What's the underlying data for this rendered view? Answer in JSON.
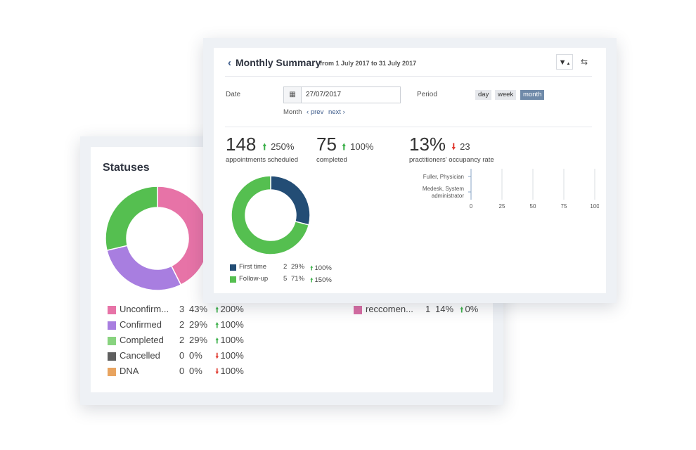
{
  "statuses": {
    "title": "Statuses",
    "items": [
      {
        "label": "Unconfirm...",
        "count": "3",
        "percent": "43%",
        "change": "200%",
        "direction": "up",
        "color": "#e773a7"
      },
      {
        "label": "Confirmed",
        "count": "2",
        "percent": "29%",
        "change": "100%",
        "direction": "up",
        "color": "#a87ee0"
      },
      {
        "label": "Completed",
        "count": "2",
        "percent": "29%",
        "change": "100%",
        "direction": "up",
        "color": "#88d37f"
      },
      {
        "label": "Cancelled",
        "count": "0",
        "percent": "0%",
        "change": "100%",
        "direction": "down",
        "color": "#5f5f5f"
      },
      {
        "label": "DNA",
        "count": "0",
        "percent": "0%",
        "change": "100%",
        "direction": "down",
        "color": "#e8a460"
      }
    ],
    "extra_item": {
      "label": "reccomen...",
      "count": "1",
      "percent": "14%",
      "change": "0%",
      "direction": "up",
      "color": "#d96ea5"
    },
    "donut": [
      {
        "name": "Unconfirmed",
        "value": 43,
        "color": "#e773a7"
      },
      {
        "name": "Confirmed",
        "value": 29,
        "color": "#a87ee0"
      },
      {
        "name": "Completed",
        "value": 29,
        "color": "#55bf50"
      }
    ]
  },
  "summary": {
    "back_icon": "chevron-left-icon",
    "title": "Monthly Summary",
    "range": "from 1 July 2017 to 31 July 2017",
    "filter_icon": "filter-icon",
    "refresh_icon": "refresh-icon",
    "date_label": "Date",
    "date_value": "27/07/2017",
    "calendar_icon": "calendar-icon",
    "month_label": "Month",
    "prev_label": "prev",
    "next_label": "next",
    "period_label": "Period",
    "periods": [
      {
        "label": "day",
        "active": false
      },
      {
        "label": "week",
        "active": false
      },
      {
        "label": "month",
        "active": true
      }
    ],
    "kpis": [
      {
        "value": "148",
        "change": "250%",
        "direction": "up",
        "label": "appointments scheduled"
      },
      {
        "value": "75",
        "change": "100%",
        "direction": "up",
        "label": "completed"
      },
      {
        "value": "13%",
        "change": "23",
        "direction": "down",
        "label": "practitioners' occupancy rate"
      }
    ],
    "legend": [
      {
        "label": "First time",
        "count": "2",
        "percent": "29%",
        "change": "100%",
        "direction": "up",
        "color": "#234d75"
      },
      {
        "label": "Follow-up",
        "count": "5",
        "percent": "71%",
        "change": "150%",
        "direction": "up",
        "color": "#55bf50"
      }
    ],
    "donut": [
      {
        "name": "First time",
        "value": 29,
        "color": "#234d75"
      },
      {
        "name": "Follow-up",
        "value": 71,
        "color": "#55bf50"
      }
    ]
  },
  "chart_data": {
    "type": "bar",
    "categories": [
      "Fuller, Physician",
      "Medesk, System administrator"
    ],
    "category_lines": [
      [
        "Fuller, Physician"
      ],
      [
        "Medesk, System",
        "administrator"
      ]
    ],
    "values": [
      0,
      0
    ],
    "xlim": [
      0,
      100
    ],
    "xticks": [
      "0",
      "25",
      "50",
      "75",
      "100"
    ],
    "orientation": "horizontal",
    "grid": true
  }
}
